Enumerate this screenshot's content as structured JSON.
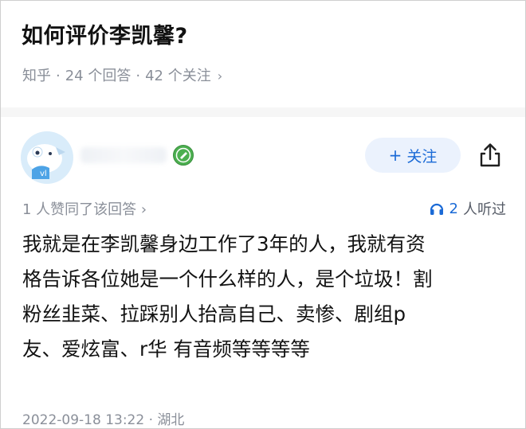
{
  "question": {
    "title": "如何评价李凯馨?",
    "source": "知乎",
    "answers_count": "24 个回答",
    "followers_count": "42 个关注",
    "separator": "·",
    "chevron": "›"
  },
  "answer": {
    "follow_button": {
      "plus": "+",
      "label": "关注"
    },
    "upvote_text": "1 人赞同了该回答",
    "upvote_chevron": "›",
    "listen_count": "2",
    "listen_suffix": "人听过",
    "body_lines": [
      "我就是在李凯馨身边工作了3年的人，我就有资",
      "格告诉各位她是一个什么样的人，是个垃圾！割",
      "粉丝韭菜、拉踩别人抬高自己、卖惨、剧组p",
      "友、爱炫富、r华 有音频等等等等"
    ],
    "date_location": "2022-09-18 13:22 · 湖北"
  },
  "icons": {
    "avatar": "avatar-illustration",
    "badge": "verified-badge-icon",
    "share": "share-icon",
    "headphones": "headphones-icon"
  },
  "colors": {
    "primary_text": "#121212",
    "secondary_text": "#8a8f99",
    "accent_blue": "#1a6ad6",
    "follow_bg": "#ebf2fd",
    "badge_green": "#4caf50"
  }
}
